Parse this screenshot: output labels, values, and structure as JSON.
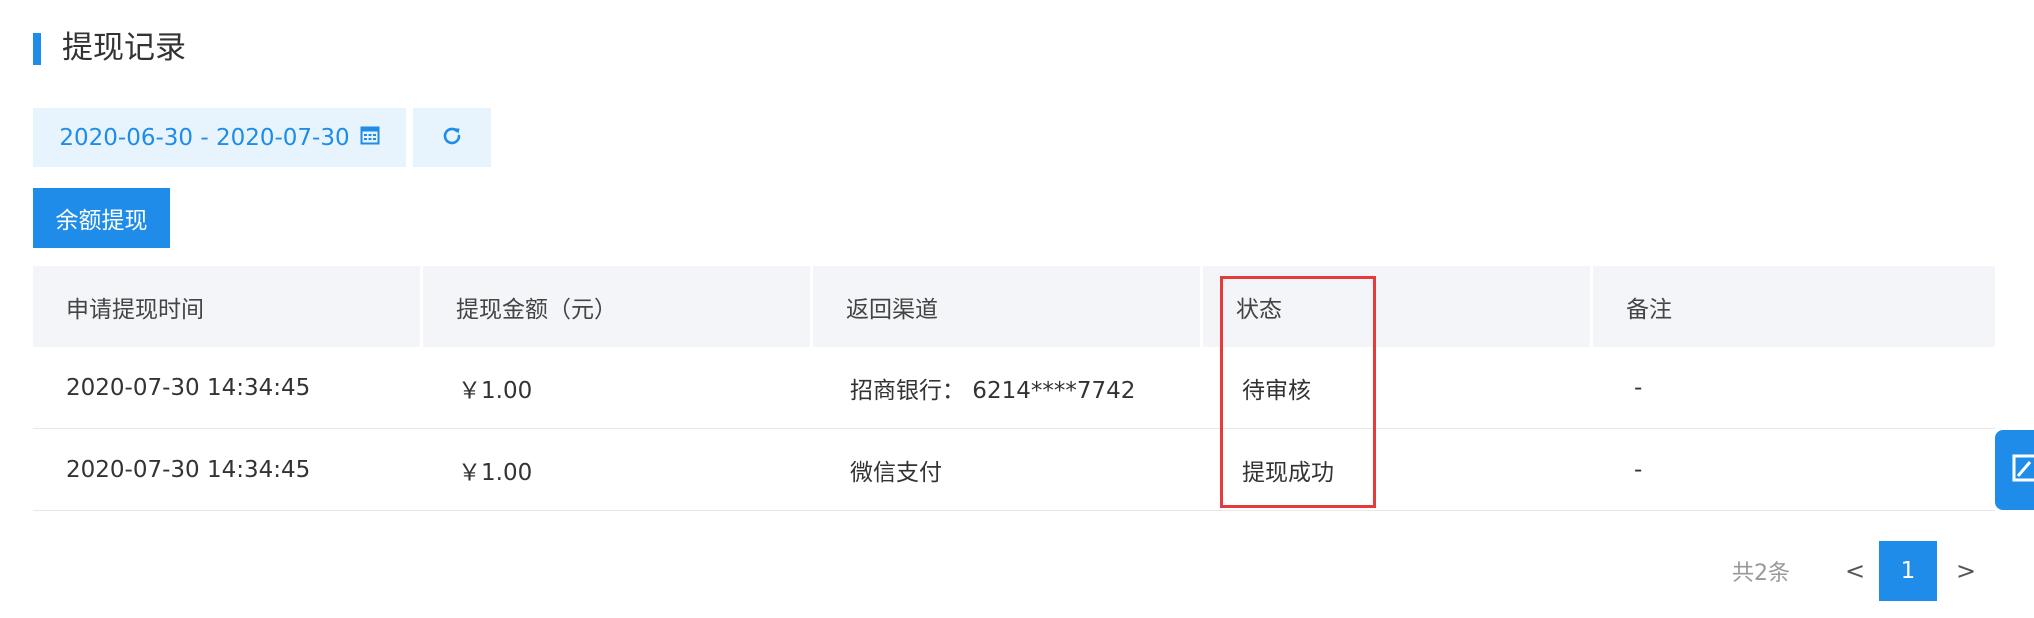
{
  "page": {
    "title": "提现记录"
  },
  "filters": {
    "date_range": "2020-06-30 - 2020-07-30",
    "calendar_icon": "calendar-icon",
    "refresh_icon": "refresh-icon"
  },
  "actions": {
    "withdraw_label": "余额提现"
  },
  "table": {
    "columns": [
      "申请提现时间",
      "提现金额（元）",
      "返回渠道",
      "状态",
      "备注"
    ],
    "rows": [
      [
        "2020-07-30 14:34:45",
        "￥1.00",
        "招商银行： 6214****7742",
        "待审核",
        "-"
      ],
      [
        "2020-07-30 14:34:45",
        "￥1.00",
        "微信支付",
        "提现成功",
        "-"
      ]
    ]
  },
  "pagination": {
    "total": "共2条",
    "prev": "<",
    "current": "1",
    "next": ">"
  },
  "colors": {
    "accent": "#1e8ce8",
    "highlight": "#e53b3b",
    "header_bg": "#f3f5f8"
  },
  "side_widget": {
    "icon": "edit-icon"
  }
}
